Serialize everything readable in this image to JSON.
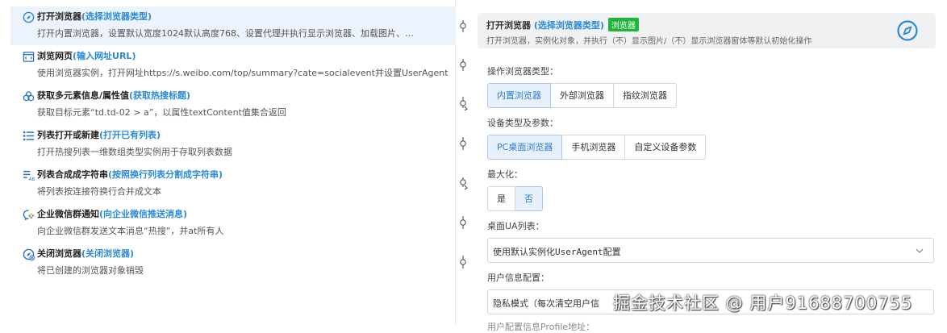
{
  "steps": [
    {
      "title": "打开浏览器",
      "subtitle": "(选择浏览器类型)",
      "desc": "打开内置浏览器，设置默认宽度1024默认高度768、设置代理并执行显示浏览器、加载图片、…",
      "icon": "compass-icon"
    },
    {
      "title": "浏览网页",
      "subtitle": "(输入网址URL)",
      "desc": "使用浏览器实例，打开网址https://s.weibo.com/top/summary?cate=socialevent并设置UserAgent",
      "icon": "web-page-icon"
    },
    {
      "title": "获取多元素信息/属性值",
      "subtitle": "(获取热搜标题)",
      "desc": "获取目标元素“td.td-02 > a”，以属性textContent值集合返回",
      "icon": "multi-element-icon"
    },
    {
      "title": "列表打开或新建",
      "subtitle": "(打开已有列表)",
      "desc": "打开热搜列表一维数组类型实例用于存取列表数据",
      "icon": "list-icon"
    },
    {
      "title": "列表合成成字符串",
      "subtitle": "(按照换行列表分割成字符串)",
      "desc": "将列表按连接符换行合并成文本",
      "icon": "list-join-icon"
    },
    {
      "title": "企业微信群通知",
      "subtitle": "(向企业微信推送消息)",
      "desc": "向企业微信群发送文本消息“热搜”，并at所有人",
      "icon": "wecom-icon"
    },
    {
      "title": "关闭浏览器",
      "subtitle": "(关闭浏览器)",
      "desc": "将已创建的浏览器对象销毁",
      "icon": "close-browser-icon"
    }
  ],
  "panel": {
    "title": "打开浏览器",
    "subtitle": "(选择浏览器类型)",
    "badge": "浏览器",
    "desc": "打开浏览器，实例化对象，并执行（不）显示图片/（不）显示浏览器窗体等默认初始化操作",
    "browser_type": {
      "label": "操作浏览器类型：",
      "options": [
        "内置浏览器",
        "外部浏览器",
        "指纹浏览器"
      ],
      "selected": 0
    },
    "device": {
      "label": "设备类型及参数：",
      "options": [
        "PC桌面浏览器",
        "手机浏览器",
        "自定义设备参数"
      ],
      "selected": 0
    },
    "maximize": {
      "label": "最大化：",
      "options": [
        "是",
        "否"
      ],
      "selected": 1
    },
    "ua": {
      "label": "桌面UA列表：",
      "value": "使用默认实例化UserAgent配置"
    },
    "user_info": {
      "label": "用户信息配置：",
      "value": "隐私模式（每次清空用户信"
    },
    "next_label": "用户配置信息Profile地址："
  },
  "watermark": "掘金技术社区 @ 用户91688700755",
  "colors": {
    "accent": "#2a8ad6",
    "badge": "#1fb53a",
    "active_row": "#edf3fc"
  }
}
